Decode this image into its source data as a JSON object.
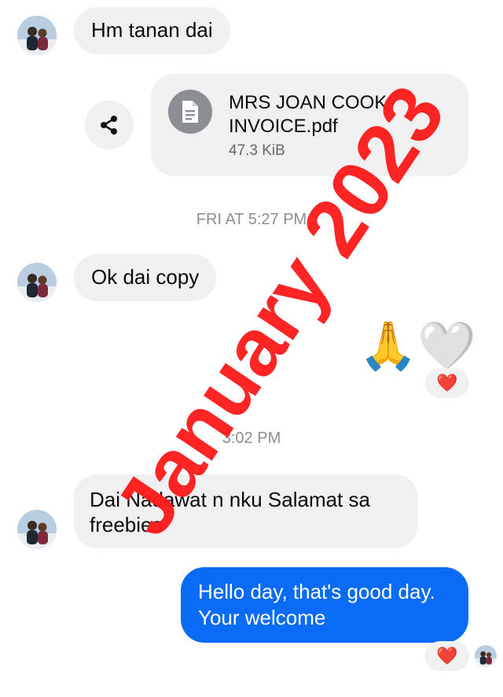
{
  "messages": {
    "m1_text": "Hm tanan dai",
    "file": {
      "name_line1": "MRS JOAN COOK",
      "name_line2": "INVOICE.pdf",
      "size": "47.3 KiB"
    },
    "ts1": "FRI AT 5:27 PM",
    "m2_text": "Ok dai copy",
    "m3_emoji": "🙏🤍",
    "m3_reaction": "❤️",
    "ts2": "3:02 PM",
    "m4_text": "Dai Nadawat n nku Salamat sa freebies",
    "m5_text": "Hello day, that's good day. Your welcome",
    "m5_reaction": "❤️"
  },
  "watermark": {
    "text": "January 2023",
    "color": "#ff1a1a"
  },
  "colors": {
    "outgoing_bubble": "#0a6cf5",
    "incoming_bubble": "#f0f0f0",
    "timestamp": "#8a8d91"
  }
}
